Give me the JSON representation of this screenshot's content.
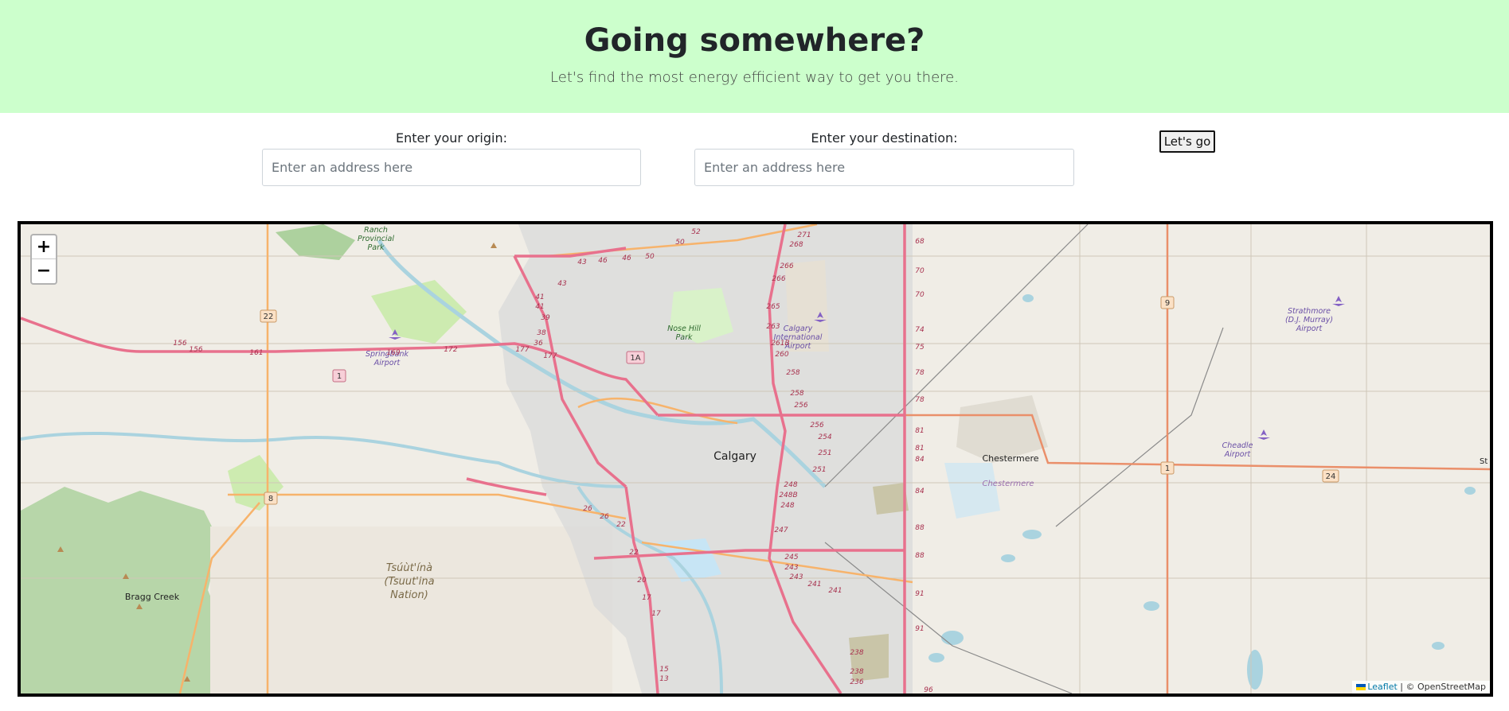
{
  "header": {
    "title": "Going somewhere?",
    "subtitle": "Let's find the most energy efficient way to get you there."
  },
  "form": {
    "origin_label": "Enter your origin:",
    "origin_placeholder": "Enter an address here",
    "origin_value": "",
    "destination_label": "Enter your destination:",
    "destination_placeholder": "Enter an address here",
    "destination_value": "",
    "submit_label": "Let's go"
  },
  "map": {
    "zoom_in": "+",
    "zoom_out": "−",
    "attribution_link": "Leaflet",
    "attribution_text": " | © OpenStreetMap",
    "places": {
      "calgary": "Calgary",
      "chestermere": "Chestermere",
      "chestermere_area": "Chestermere",
      "bragg_creek": "Bragg Creek",
      "nose_hill_1": "Nose Hill",
      "nose_hill_2": "Park",
      "ranch_1": "Ranch",
      "ranch_2": "Provincial",
      "ranch_3": "Park",
      "springbank_1": "Springbank",
      "springbank_2": "Airport",
      "yyc_1": "Calgary",
      "yyc_2": "International",
      "yyc_3": "Airport",
      "strathmore_1": "Strathmore",
      "strathmore_2": "(D.J. Murray)",
      "strathmore_3": "Airport",
      "cheadle_1": "Cheadle",
      "cheadle_2": "Airport",
      "tsuutina_1": "Tsúùt'ínà",
      "tsuutina_2": "(Tsuut'ina",
      "tsuutina_3": "Nation)",
      "edge_st": "St"
    },
    "shields": {
      "hwy22": "22",
      "hwy1_west": "1",
      "hwy1a": "1A",
      "hwy8": "8",
      "hwy9": "9",
      "hwy1_east": "1",
      "hwy24": "24"
    },
    "exits": {
      "e156a": "156",
      "e156b": "156",
      "e161": "161",
      "e169": "169",
      "e172": "172",
      "e177a": "177",
      "e177b": "177",
      "e43a": "43",
      "e43b": "43",
      "e46a": "46",
      "e46b": "46",
      "e50a": "50",
      "e50b": "50",
      "e52": "52",
      "e41a": "41",
      "e41b": "41",
      "e39": "39",
      "e38": "38",
      "e36": "36",
      "e271": "271",
      "e268": "268",
      "e266a": "266",
      "e266b": "266",
      "e265": "265",
      "e263": "263",
      "e261b": "261B",
      "e260": "260",
      "e258a": "258",
      "e258b": "258",
      "e256a": "256",
      "e256b": "256",
      "e254": "254",
      "e251a": "251",
      "e251b": "251",
      "e248": "248",
      "e248b": "248B",
      "e248c": "248",
      "e247": "247",
      "e245": "245",
      "e243a": "243",
      "e243b": "243",
      "e241a": "241",
      "e241b": "241",
      "e238a": "238",
      "e238b": "238",
      "e236": "236",
      "e68": "68",
      "e70a": "70",
      "e70b": "70",
      "e74": "74",
      "e75": "75",
      "e78a": "78",
      "e78b": "78",
      "e81a": "81",
      "e81b": "81",
      "e84a": "84",
      "e84b": "84",
      "e88a": "88",
      "e88b": "88",
      "e91a": "91",
      "e91b": "91",
      "e96": "96",
      "e26a": "26",
      "e26b": "26",
      "e22a": "22",
      "e22b": "22",
      "e20": "20",
      "e17a": "17",
      "e17b": "17",
      "e15": "15",
      "e13": "13"
    }
  }
}
